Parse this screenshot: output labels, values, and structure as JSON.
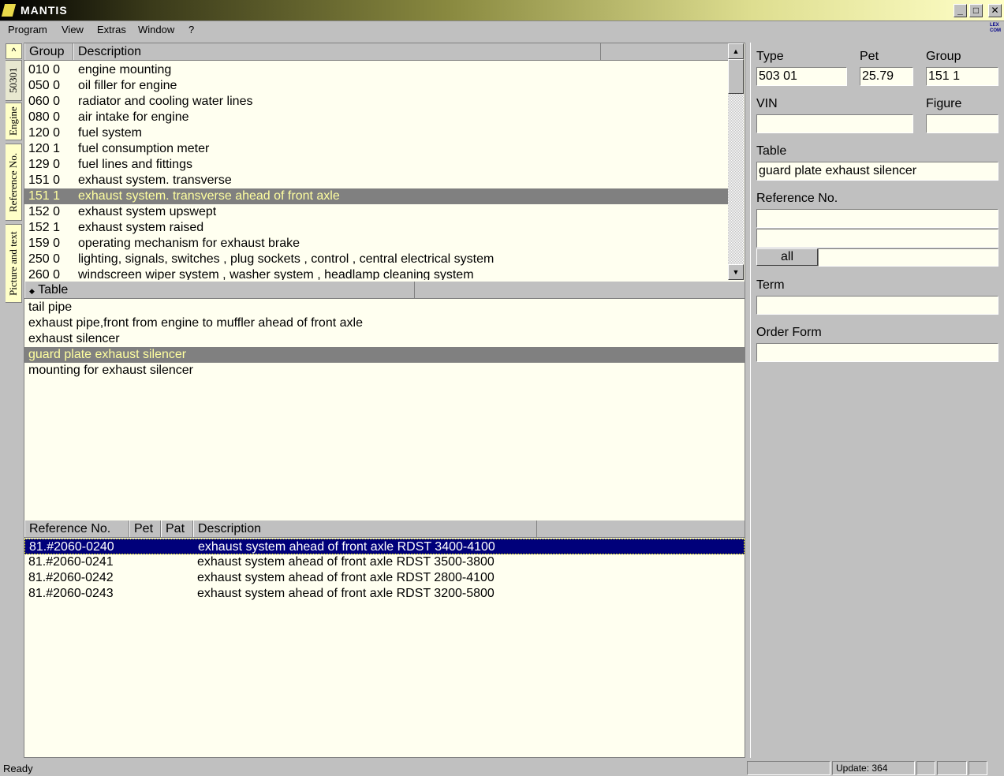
{
  "window": {
    "title": "MANTIS",
    "minimize": "_",
    "maximize": "□",
    "close": "✕"
  },
  "menu": [
    "Program",
    "View",
    "Extras",
    "Window",
    "?"
  ],
  "brand_logo": "LEX COM",
  "side_tabs": {
    "up": "^",
    "tabs": [
      "50301",
      "Engine",
      "Reference No.",
      "Picture and text"
    ]
  },
  "groups": {
    "headers": [
      "Group",
      "Description"
    ],
    "rows": [
      {
        "group": "010 0",
        "desc": "engine mounting"
      },
      {
        "group": "050 0",
        "desc": "oil filler for engine"
      },
      {
        "group": "060 0",
        "desc": "radiator and cooling water lines"
      },
      {
        "group": "080 0",
        "desc": "air intake for engine"
      },
      {
        "group": "120 0",
        "desc": "fuel system"
      },
      {
        "group": "120 1",
        "desc": "fuel consumption meter"
      },
      {
        "group": "129 0",
        "desc": "fuel lines and fittings"
      },
      {
        "group": "151 0",
        "desc": "exhaust system. transverse"
      },
      {
        "group": "151 1",
        "desc": "exhaust system. transverse ahead of front axle"
      },
      {
        "group": "152 0",
        "desc": "exhaust system upswept"
      },
      {
        "group": "152 1",
        "desc": "exhaust system raised"
      },
      {
        "group": "159 0",
        "desc": "operating mechanism for exhaust brake"
      },
      {
        "group": "250 0",
        "desc": "lighting, signals, switches , plug sockets , control , central electrical system"
      },
      {
        "group": "260 0",
        "desc": "windscreen wiper system , washer system , headlamp cleaning system"
      }
    ],
    "selected_index": 8
  },
  "tables": {
    "header": "Table",
    "header_icon": "◆",
    "rows": [
      "tail pipe",
      "exhaust pipe,front from engine to muffler ahead of front axle",
      "exhaust silencer",
      "guard plate exhaust silencer",
      "mounting for exhaust silencer"
    ],
    "selected_index": 3
  },
  "refs": {
    "headers": [
      "Reference No.",
      "Pet",
      "Pat",
      "Description"
    ],
    "rows": [
      {
        "ref": "81.#2060-0240",
        "pet": "",
        "pat": "",
        "desc": "exhaust system ahead of front axle RDST 3400-4100"
      },
      {
        "ref": "81.#2060-0241",
        "pet": "",
        "pat": "",
        "desc": "exhaust system ahead of front axle RDST 3500-3800"
      },
      {
        "ref": "81.#2060-0242",
        "pet": "",
        "pat": "",
        "desc": "exhaust system ahead of front axle RDST 2800-4100"
      },
      {
        "ref": "81.#2060-0243",
        "pet": "",
        "pat": "",
        "desc": "exhaust system ahead of front axle RDST 3200-5800"
      }
    ],
    "selected_index": 0
  },
  "info": {
    "type_label": "Type",
    "type_value": "503 01",
    "pet_label": "Pet",
    "pet_value": "25.79",
    "group_label": "Group",
    "group_value": "151 1",
    "vin_label": "VIN",
    "vin_value": "",
    "figure_label": "Figure",
    "figure_value": "",
    "table_label": "Table",
    "table_value": "guard plate exhaust silencer",
    "ref_label": "Reference No.",
    "ref_value1": "",
    "ref_value2": "",
    "all_label": "all",
    "all_value": "",
    "term_label": "Term",
    "term_value": "",
    "order_label": "Order Form",
    "order_value": ""
  },
  "status": {
    "text": "Ready",
    "update": "Update: 364"
  }
}
